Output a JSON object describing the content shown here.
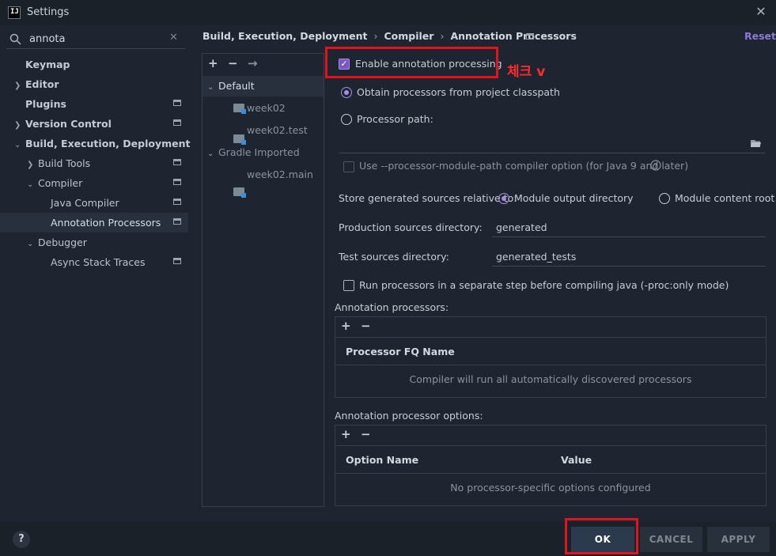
{
  "window": {
    "title": "Settings",
    "app_icon_text": "IJ"
  },
  "search": {
    "value": "annota"
  },
  "sidebar": {
    "items": [
      {
        "label": "Keymap"
      },
      {
        "label": "Editor"
      },
      {
        "label": "Plugins"
      },
      {
        "label": "Version Control"
      },
      {
        "label": "Build, Execution, Deployment"
      },
      {
        "label": "Build Tools"
      },
      {
        "label": "Compiler"
      },
      {
        "label": "Java Compiler"
      },
      {
        "label": "Annotation Processors"
      },
      {
        "label": "Debugger"
      },
      {
        "label": "Async Stack Traces"
      }
    ]
  },
  "breadcrumb": {
    "items": [
      "Build, Execution, Deployment",
      "Compiler",
      "Annotation Processors"
    ],
    "sep": "›"
  },
  "reset_label": "Reset",
  "profiles": {
    "toolbar": {
      "add": "+",
      "remove": "−",
      "move": "→"
    },
    "items": [
      {
        "label": "Default"
      },
      {
        "label": "week02"
      },
      {
        "label": "week02.test"
      },
      {
        "label": "Gradle Imported"
      },
      {
        "label": "week02.main"
      }
    ]
  },
  "settings": {
    "enable_label": "Enable annotation processing",
    "enable_checked": true,
    "annotation_note": "체크 v",
    "obtain_label": "Obtain processors from project classpath",
    "path_label": "Processor path:",
    "module_path_label": "Use --processor-module-path compiler option (for Java 9 and later)",
    "store_label": "Store generated sources relative to:",
    "module_output_label": "Module output directory",
    "module_content_label": "Module content root",
    "prod_label": "Production sources directory:",
    "prod_value": "generated",
    "test_label": "Test sources directory:",
    "test_value": "generated_tests",
    "run_sep_label": "Run processors in a separate step before compiling java (-proc:only mode)"
  },
  "processors_table": {
    "title": "Annotation processors:",
    "add": "+",
    "remove": "−",
    "header": "Processor FQ Name",
    "empty": "Compiler will run all automatically discovered processors"
  },
  "options_table": {
    "title": "Annotation processor options:",
    "add": "+",
    "remove": "−",
    "headers": [
      "Option Name",
      "Value"
    ],
    "empty": "No processor-specific options configured"
  },
  "buttons": {
    "help": "?",
    "ok": "OK",
    "cancel": "CANCEL",
    "apply": "APPLY"
  },
  "colors": {
    "accent": "#a58fe0",
    "highlight_box": "#e0141e",
    "link": "#8c7ad6"
  }
}
